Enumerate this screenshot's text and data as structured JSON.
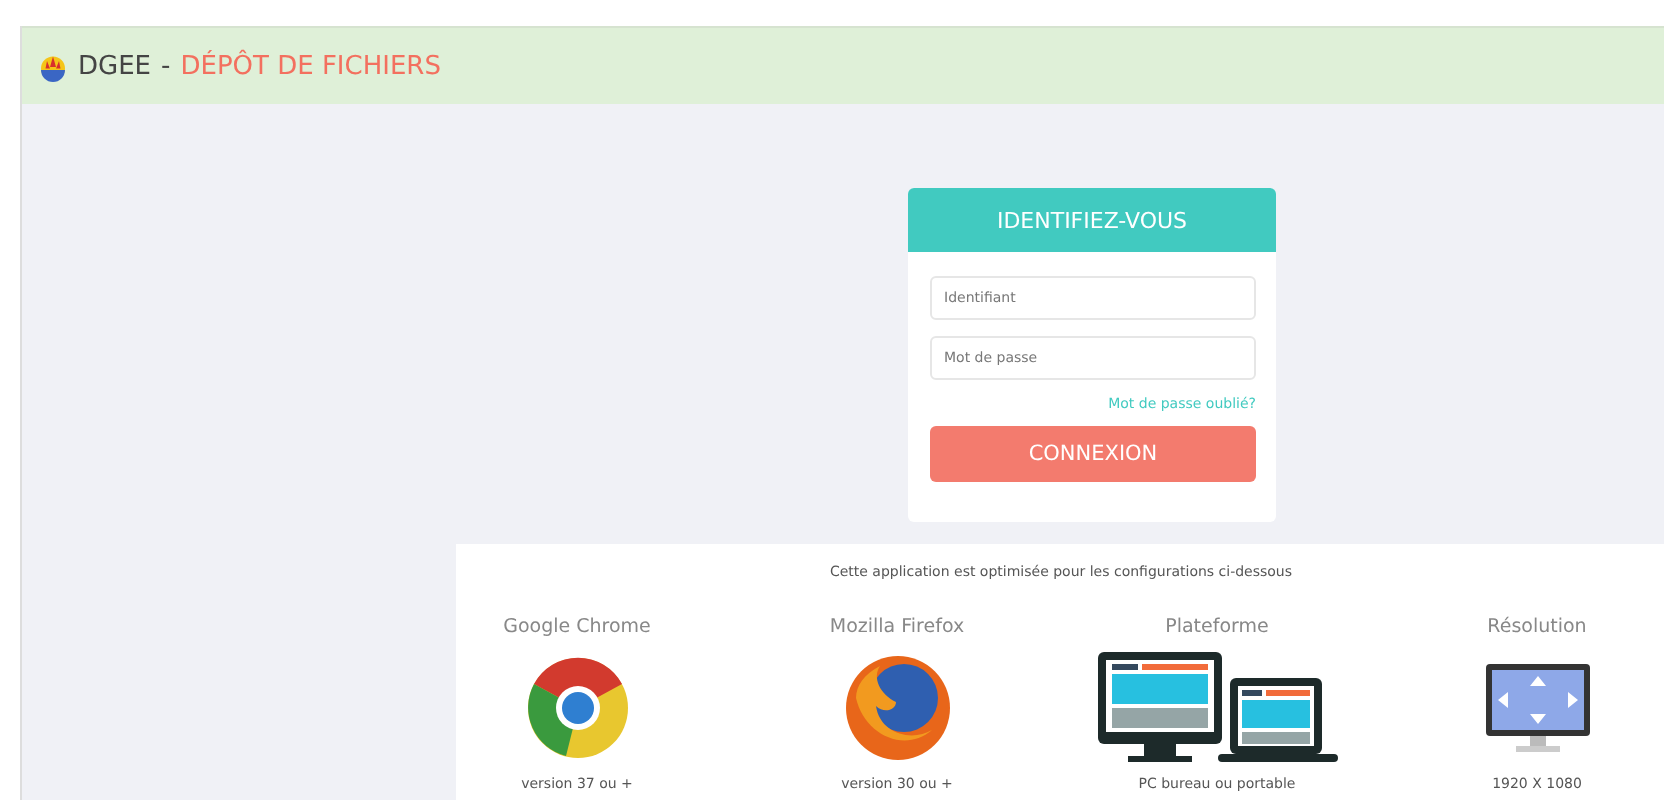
{
  "header": {
    "brand": "DGEE",
    "separator": "-",
    "title": "DÉPÔT DE FICHIERS"
  },
  "login": {
    "title": "IDENTIFIEZ-VOUS",
    "fields": [
      {
        "placeholder": "Identifiant"
      },
      {
        "placeholder": "Mot de passe"
      }
    ],
    "forgot_link": "Mot de passe oublié?",
    "submit": "CONNEXION"
  },
  "requirements": {
    "intro": "Cette application est optimisée pour les configurations ci-dessous",
    "items": [
      {
        "kind": "chrome",
        "title": "Google Chrome",
        "caption": "version 37 ou +"
      },
      {
        "kind": "firefox",
        "title": "Mozilla Firefox",
        "caption": "version 30 ou +"
      },
      {
        "kind": "platform",
        "title": "Plateforme",
        "caption": "PC bureau ou portable"
      },
      {
        "kind": "resolution",
        "title": "Résolution",
        "caption": "1920 X 1080"
      }
    ]
  }
}
